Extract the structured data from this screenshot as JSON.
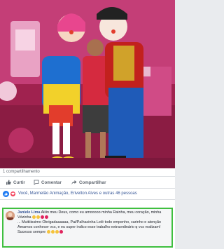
{
  "post": {
    "share_count": "1 compartilhamento"
  },
  "actions": [
    {
      "label": "Curtir",
      "icon": "thumbs-up-icon"
    },
    {
      "label": "Comentar",
      "icon": "comment-icon"
    },
    {
      "label": "Compartilhar",
      "icon": "share-icon"
    }
  ],
  "reactions": {
    "text": "Você, Marmelão Animação, Erivelton Alves e outras 46 pessoas",
    "icons": [
      "like-icon",
      "heart-icon"
    ]
  },
  "comment": {
    "author": "Janiele Lima",
    "line1": "Aiiiin meu Deus, como eu amooooo minha Rainha, meu coração, minha Vózinha",
    "line2": "... Muitiiissimo Obrigadaaaaaa, Pai/Palhacinha Lelé todo empenho, carinho e atenção",
    "line3": "Amamos conhecer vcs, e eu super indico esse trabalho extraordinário q vcs realizam!",
    "line4": "Sucesso sempre"
  },
  "colors": {
    "facebook_blue": "#385898",
    "highlight_border": "#3fbf3f",
    "heart": "#f33e58",
    "like": "#1877f2"
  }
}
